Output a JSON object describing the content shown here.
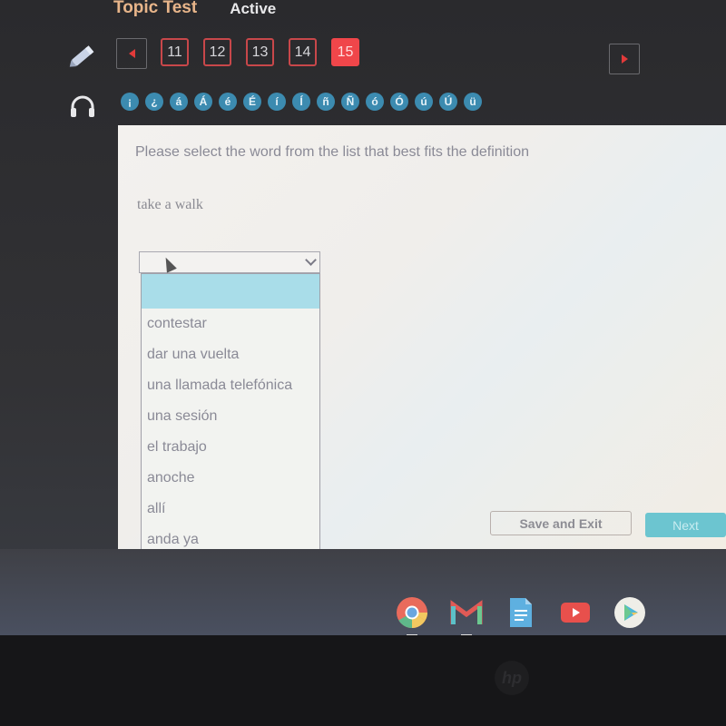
{
  "header": {
    "title": "Topic Test",
    "status": "Active"
  },
  "navigation": {
    "prev_icon": "triangle-left-icon",
    "next_icon": "triangle-right-icon",
    "pages": [
      {
        "label": "11",
        "active": false
      },
      {
        "label": "12",
        "active": false
      },
      {
        "label": "13",
        "active": false
      },
      {
        "label": "14",
        "active": false
      },
      {
        "label": "15",
        "active": true
      }
    ]
  },
  "tools": {
    "pencil_icon": "pencil-icon",
    "audio_icon": "headphones-icon"
  },
  "accent_keys": [
    "¡",
    "¿",
    "á",
    "Á",
    "é",
    "É",
    "í",
    "Í",
    "ñ",
    "Ñ",
    "ó",
    "Ó",
    "ú",
    "Ú",
    "ü"
  ],
  "question": {
    "instruction": "Please select the word from the list that best fits the definition",
    "definition": "take a walk",
    "select_value": "",
    "options": [
      "",
      "contestar",
      "dar una vuelta",
      "una llamada telefónica",
      "una sesión",
      "el trabajo",
      "anoche",
      "allí",
      "anda ya"
    ]
  },
  "buttons": {
    "save_exit": "Save and Exit",
    "next": "Next"
  },
  "shelf": {
    "apps": [
      "chrome",
      "gmail",
      "docs",
      "youtube",
      "play-store"
    ]
  },
  "device": {
    "logo": "hp"
  },
  "colors": {
    "accent_red": "#f0464a",
    "accent_key_blue": "#3c8bb0",
    "highlight": "#a9dde9",
    "next_button": "#6cc5d0",
    "title_orange": "#e8b58a"
  }
}
